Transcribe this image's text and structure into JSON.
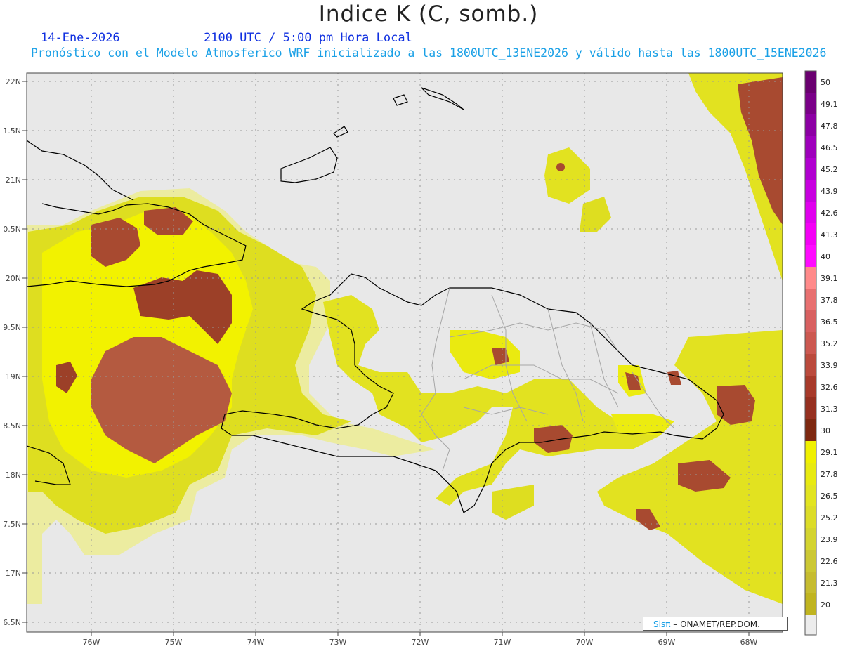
{
  "header": {
    "title": "Indice K (C, somb.)",
    "date": "14-Ene-2026",
    "time": "2100 UTC / 5:00 pm Hora Local",
    "model_line": "Pronóstico con el Modelo Atmosferico WRF inicializado a las 1800UTC_13ENE2026 y válido hasta las  1800UTC_15ENE2026"
  },
  "axes": {
    "lat_labels": [
      "22N",
      "1.5N",
      "21N",
      "0.5N",
      "20N",
      "9.5N",
      "19N",
      "8.5N",
      "18N",
      "7.5N",
      "17N",
      "6.5N"
    ],
    "lon_labels": [
      "76W",
      "75W",
      "74W",
      "73W",
      "72W",
      "71W",
      "70W",
      "69W",
      "68W"
    ]
  },
  "colorbar": {
    "labels": [
      "50",
      "49.1",
      "47.8",
      "46.5",
      "45.2",
      "43.9",
      "42.6",
      "41.3",
      "40",
      "39.1",
      "37.8",
      "36.5",
      "35.2",
      "33.9",
      "32.6",
      "31.3",
      "30",
      "29.1",
      "27.8",
      "26.5",
      "25.2",
      "23.9",
      "22.6",
      "21.3",
      "20"
    ],
    "colors": [
      "#6a0070",
      "#7a0088",
      "#8c00a4",
      "#9e00bc",
      "#b000d0",
      "#c800e0",
      "#e000ee",
      "#f400f6",
      "#ff0aff",
      "#ff8a8a",
      "#e87070",
      "#d86060",
      "#cc5850",
      "#bb4a3c",
      "#a83a2a",
      "#963020",
      "#7e2810",
      "#f0f000",
      "#e8ea10",
      "#e2e420",
      "#dcdc28",
      "#d4d430",
      "#ccc834",
      "#c6bc30",
      "#c0b420"
    ],
    "below_color": "#ececec"
  },
  "credit": {
    "brand": "Sisπ",
    "rest": "– ONAMET/REP.DOM."
  }
}
